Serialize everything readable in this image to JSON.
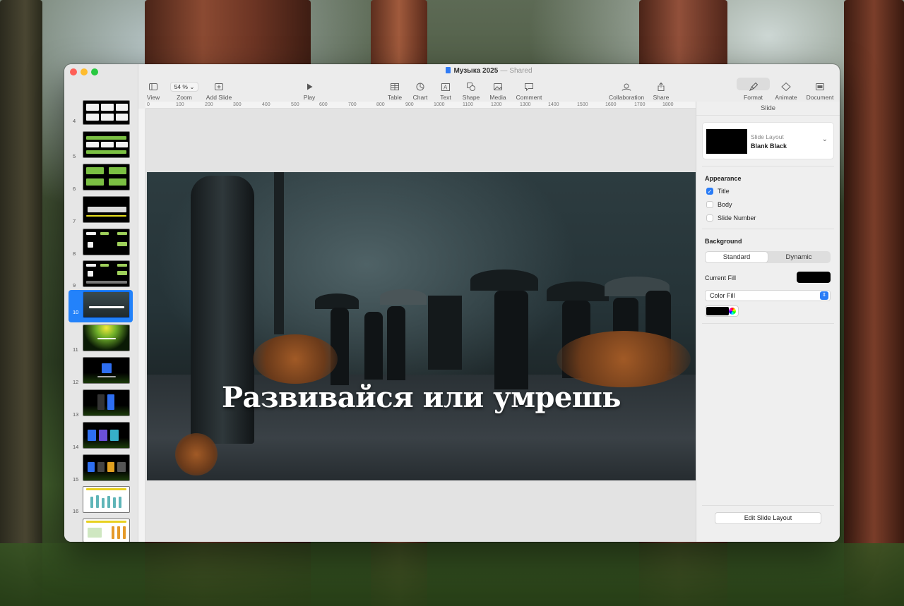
{
  "window": {
    "title": "Музыка 2025",
    "separator": "—",
    "shared_label": "Shared"
  },
  "toolbar": {
    "view": "View",
    "zoom_value": "54 %",
    "zoom": "Zoom",
    "add_slide": "Add Slide",
    "play": "Play",
    "table": "Table",
    "chart": "Chart",
    "text": "Text",
    "shape": "Shape",
    "media": "Media",
    "comment": "Comment",
    "collaboration": "Collaboration",
    "share": "Share",
    "format": "Format",
    "animate": "Animate",
    "document": "Document"
  },
  "ruler": {
    "marks": [
      "0",
      "100",
      "200",
      "300",
      "400",
      "500",
      "600",
      "700",
      "800",
      "900",
      "1000",
      "1100",
      "1200",
      "1300",
      "1400",
      "1500",
      "1600",
      "1700",
      "1800"
    ]
  },
  "slides": {
    "numbers": [
      "4",
      "5",
      "6",
      "7",
      "8",
      "9",
      "10",
      "11",
      "12",
      "13",
      "14",
      "15",
      "16"
    ],
    "selected": "10"
  },
  "slide": {
    "title": "Развивайся или умрешь"
  },
  "inspector": {
    "header": "Slide",
    "layout_caption": "Slide Layout",
    "layout_name": "Blank Black",
    "appearance": "Appearance",
    "title_checkbox": "Title",
    "body_checkbox": "Body",
    "slide_number_checkbox": "Slide Number",
    "background": "Background",
    "standard": "Standard",
    "dynamic": "Dynamic",
    "current_fill": "Current Fill",
    "fill_type": "Color Fill",
    "edit_layout": "Edit Slide Layout"
  },
  "checkboxes": {
    "title": true,
    "body": false,
    "slide_number": false
  },
  "colors": {
    "accent": "#2a7cf6",
    "selection": "#2382fa",
    "current_fill": "#000000"
  }
}
